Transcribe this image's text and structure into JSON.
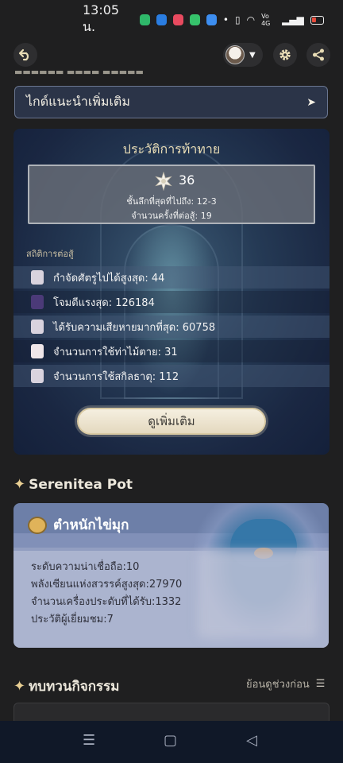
{
  "status_bar": {
    "time": "13:05 น.",
    "network_label": "Vo 4G"
  },
  "toolbar": {
    "back_icon": "back-arrow-icon",
    "settings_icon": "gear-icon",
    "share_icon": "share-icon"
  },
  "guide": {
    "label": "ไกด์แนะนำเพิ่มเติม"
  },
  "challenge": {
    "title": "ประวัติการท้าทาย",
    "stars": "36",
    "deepest": "ชั้นลึกที่สุดที่ไปถึง: 12-3",
    "battles": "จำนวนครั้งที่ต่อสู้: 19",
    "stats_heading": "สถิติการต่อสู้",
    "stats": [
      {
        "label": "กำจัดศัตรูไปได้สูงสุด: 44",
        "color": "#d9d3de"
      },
      {
        "label": "โจมตีแรงสุด: 126184",
        "color": "#4b3a78"
      },
      {
        "label": "ได้รับความเสียหายมากที่สุด: 60758",
        "color": "#d9d3de"
      },
      {
        "label": "จำนวนการใช้ท่าไม้ตาย: 31",
        "color": "#efe6e8"
      },
      {
        "label": "จำนวนการใช้สกิลธาตุ: 112",
        "color": "#d9d3de"
      }
    ],
    "more_label": "ดูเพิ่มเติม"
  },
  "serenitea": {
    "heading": "Serenitea Pot",
    "realm_name": "ตำหนักไข่มุก",
    "lines": [
      "ระดับความน่าเชื่อถือ:10",
      "พลังเซียนแห่งสวรรค์สูงสุด:27970",
      "จำนวนเครื่องประดับที่ได้รับ:1332",
      "ประวัติผู้เยี่ยมชม:7"
    ]
  },
  "events": {
    "heading": "ทบทวนกิจกรรม",
    "history_label": "ย้อนดูช่วงก่อน"
  },
  "colors": {
    "accent_gold": "#e9cf93",
    "card_blue": "#1a2742"
  }
}
